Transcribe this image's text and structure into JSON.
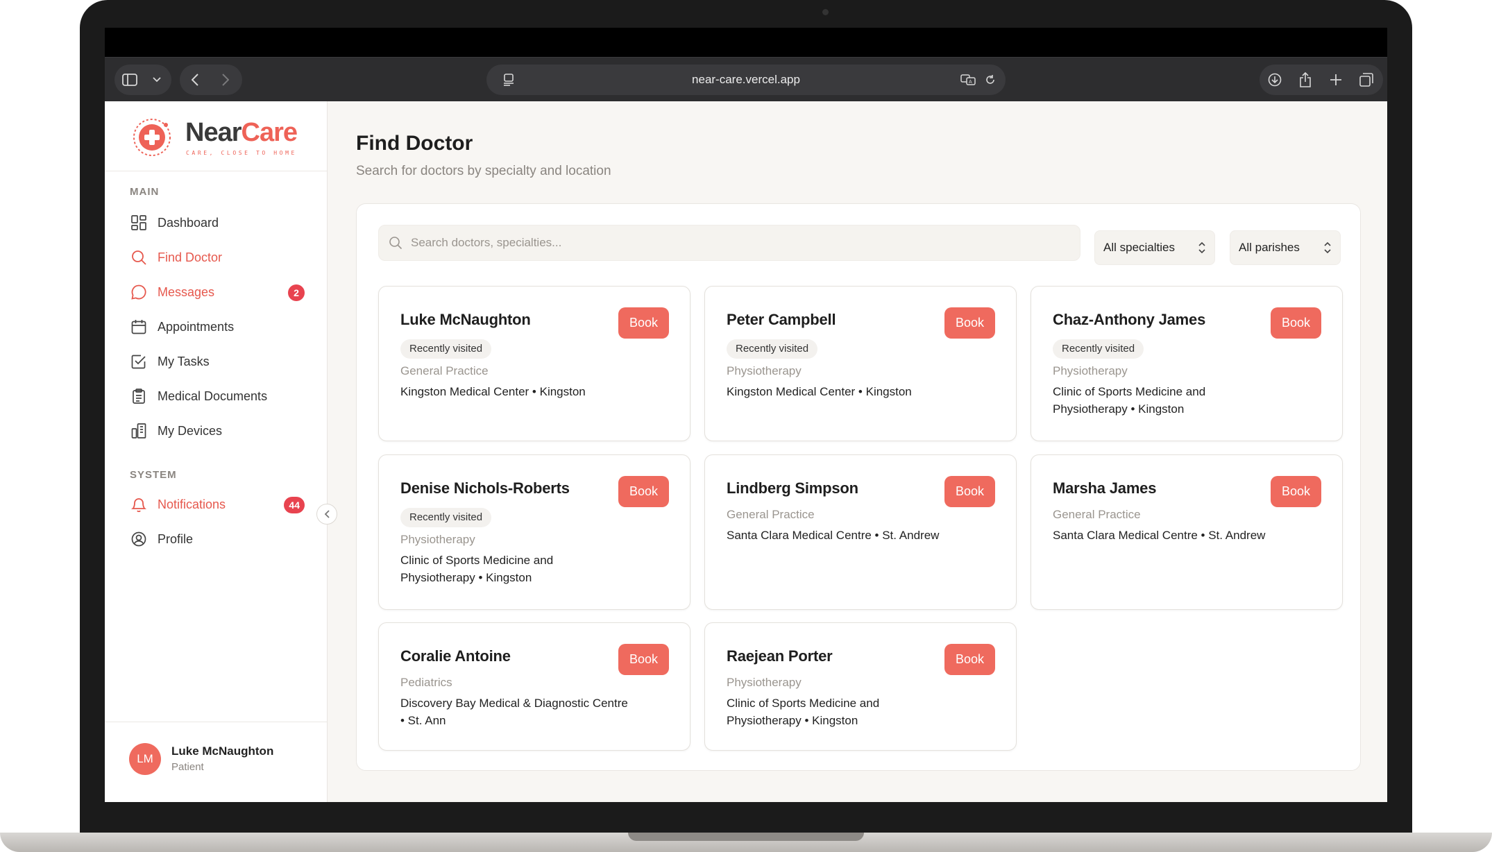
{
  "browser": {
    "url": "near-care.vercel.app"
  },
  "logo": {
    "name_part1": "Near",
    "name_part2": "Care",
    "tagline": "CARE, CLOSE TO HOME"
  },
  "sidebar": {
    "main_section": "MAIN",
    "system_section": "SYSTEM",
    "items": [
      {
        "label": "Dashboard",
        "icon": "dashboard-icon"
      },
      {
        "label": "Find Doctor",
        "icon": "search-icon",
        "active": true
      },
      {
        "label": "Messages",
        "icon": "message-icon",
        "badge": "2"
      },
      {
        "label": "Appointments",
        "icon": "calendar-icon"
      },
      {
        "label": "My Tasks",
        "icon": "check-square-icon"
      },
      {
        "label": "Medical Documents",
        "icon": "clipboard-icon"
      },
      {
        "label": "My Devices",
        "icon": "device-icon"
      }
    ],
    "system_items": [
      {
        "label": "Notifications",
        "icon": "bell-icon",
        "badge": "44"
      },
      {
        "label": "Profile",
        "icon": "user-circle-icon"
      }
    ]
  },
  "user": {
    "initials": "LM",
    "name": "Luke McNaughton",
    "role": "Patient"
  },
  "page": {
    "title": "Find Doctor",
    "subtitle": "Search for doctors by specialty and location"
  },
  "search": {
    "placeholder": "Search doctors, specialties...",
    "specialty_filter": "All specialties",
    "parish_filter": "All parishes"
  },
  "book_label": "Book",
  "recent_label": "Recently visited",
  "doctors": [
    {
      "name": "Luke McNaughton",
      "recent": true,
      "specialty": "General Practice",
      "location": "Kingston Medical Center • Kingston"
    },
    {
      "name": "Peter Campbell",
      "recent": true,
      "specialty": "Physiotherapy",
      "location": "Kingston Medical Center • Kingston"
    },
    {
      "name": "Chaz-Anthony James",
      "recent": true,
      "specialty": "Physiotherapy",
      "location": "Clinic of Sports Medicine and Physiotherapy • Kingston"
    },
    {
      "name": "Denise Nichols-Roberts",
      "recent": true,
      "specialty": "Physiotherapy",
      "location": "Clinic of Sports Medicine and Physiotherapy • Kingston"
    },
    {
      "name": "Lindberg Simpson",
      "recent": false,
      "specialty": "General Practice",
      "location": "Santa Clara Medical Centre • St. Andrew"
    },
    {
      "name": "Marsha James",
      "recent": false,
      "specialty": "General Practice",
      "location": "Santa Clara Medical Centre • St. Andrew"
    },
    {
      "name": "Coralie Antoine",
      "recent": false,
      "specialty": "Pediatrics",
      "location": "Discovery Bay Medical & Diagnostic Centre • St. Ann"
    },
    {
      "name": "Raejean Porter",
      "recent": false,
      "specialty": "Physiotherapy",
      "location": "Clinic of Sports Medicine and Physiotherapy • Kingston"
    }
  ],
  "colors": {
    "accent": "#ef6a5e",
    "badge": "#e8434f"
  }
}
